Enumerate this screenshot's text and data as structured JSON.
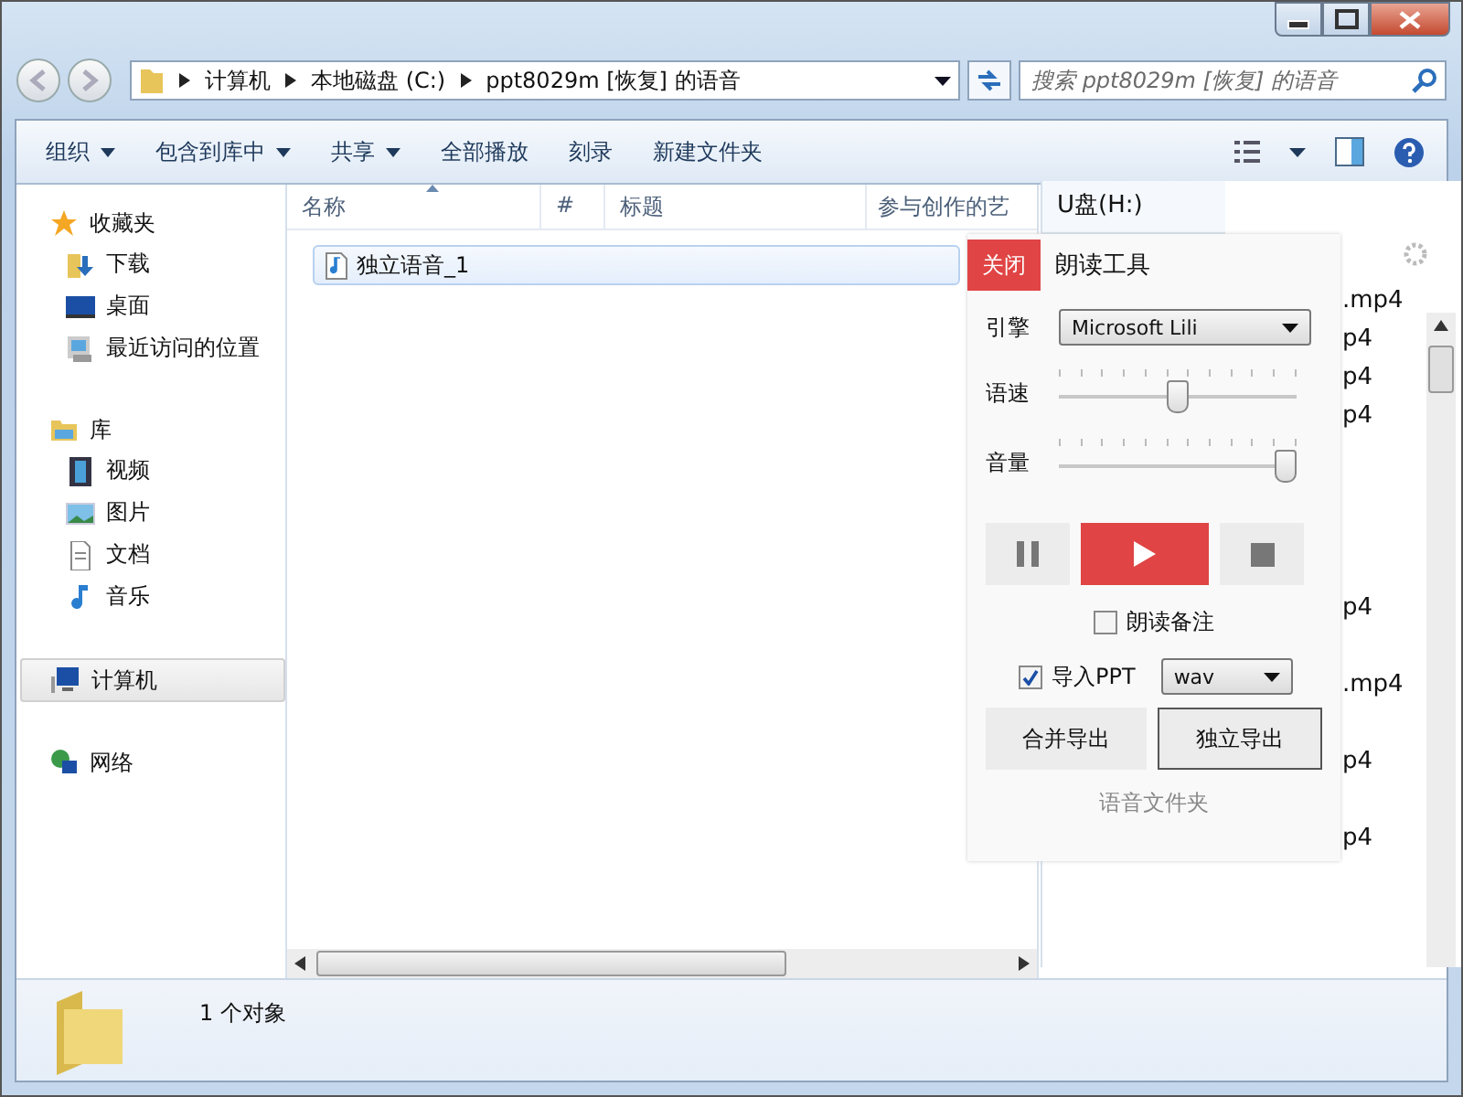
{
  "address": {
    "crumbs": [
      "计算机",
      "本地磁盘 (C:)",
      "ppt8029m [恢复] 的语音"
    ]
  },
  "search": {
    "placeholder": "搜索 ppt8029m [恢复] 的语音"
  },
  "toolbar": [
    {
      "label": "组织",
      "dropdown": true
    },
    {
      "label": "包含到库中",
      "dropdown": true
    },
    {
      "label": "共享",
      "dropdown": true
    },
    {
      "label": "全部播放",
      "dropdown": false
    },
    {
      "label": "刻录",
      "dropdown": false
    },
    {
      "label": "新建文件夹",
      "dropdown": false
    }
  ],
  "sidebar": [
    {
      "label": "收藏夹",
      "selected": false,
      "children": [
        {
          "label": "下载"
        },
        {
          "label": "桌面"
        },
        {
          "label": "最近访问的位置"
        }
      ]
    },
    {
      "label": "库",
      "selected": false,
      "children": [
        {
          "label": "视频"
        },
        {
          "label": "图片"
        },
        {
          "label": "文档"
        },
        {
          "label": "音乐"
        }
      ]
    },
    {
      "label": "计算机",
      "selected": true
    },
    {
      "label": "网络",
      "selected": false
    }
  ],
  "columns": [
    "名称",
    "#",
    "标题",
    "参与创作的艺"
  ],
  "files": [
    {
      "name": "独立语音_1",
      "selected": true
    }
  ],
  "status_bar": {
    "text": "1 个对象"
  },
  "back_window": {
    "title": "U盘(H:)",
    "items": [
      ".mp4",
      "p4",
      "p4",
      "p4",
      "p4",
      ".mp4",
      "p4",
      "p4"
    ]
  },
  "reader": {
    "close": "关闭",
    "title": "朗读工具",
    "engine": {
      "label": "引擎",
      "value": "Microsoft Lili"
    },
    "sliders": [
      {
        "label": "语速",
        "level": 0.5
      },
      {
        "label": "音量",
        "level": 1.0
      }
    ],
    "transport": [
      {
        "kind": "pause",
        "active": false
      },
      {
        "kind": "play",
        "active": true
      },
      {
        "kind": "stop",
        "active": false
      }
    ],
    "read_notes": {
      "label": "朗读备注",
      "checked": false
    },
    "import_ppt": {
      "label": "导入PPT",
      "checked": true
    },
    "format": {
      "value": "wav"
    },
    "exports": [
      {
        "label": "合并导出",
        "focused": false
      },
      {
        "label": "独立导出",
        "focused": true
      }
    ],
    "folder_link": "语音文件夹"
  }
}
